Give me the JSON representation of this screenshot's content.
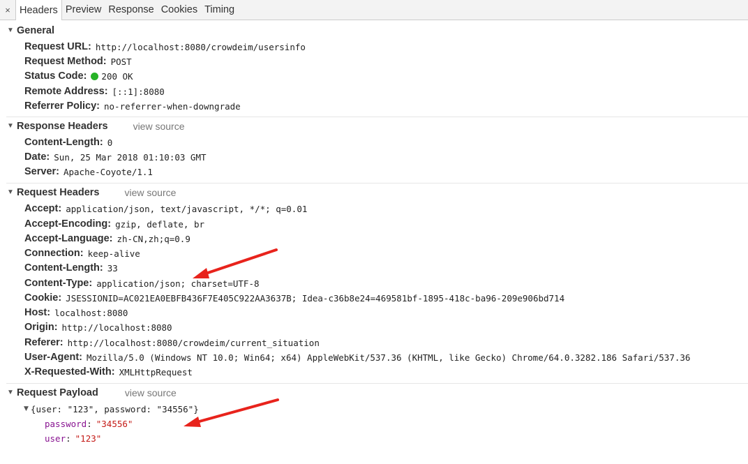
{
  "tabs": {
    "close": "×",
    "items": [
      "Headers",
      "Preview",
      "Response",
      "Cookies",
      "Timing"
    ]
  },
  "general": {
    "title": "General",
    "rows": [
      {
        "key": "Request URL:",
        "value": "http://localhost:8080/crowdeim/usersinfo"
      },
      {
        "key": "Request Method:",
        "value": "POST"
      },
      {
        "key": "Status Code:",
        "value": "200 OK"
      },
      {
        "key": "Remote Address:",
        "value": "[::1]:8080"
      },
      {
        "key": "Referrer Policy:",
        "value": "no-referrer-when-downgrade"
      }
    ]
  },
  "response_headers": {
    "title": "Response Headers",
    "view_source": "view source",
    "rows": [
      {
        "key": "Content-Length:",
        "value": "0"
      },
      {
        "key": "Date:",
        "value": "Sun, 25 Mar 2018 01:10:03 GMT"
      },
      {
        "key": "Server:",
        "value": "Apache-Coyote/1.1"
      }
    ]
  },
  "request_headers": {
    "title": "Request Headers",
    "view_source": "view source",
    "rows": [
      {
        "key": "Accept:",
        "value": "application/json, text/javascript, */*; q=0.01"
      },
      {
        "key": "Accept-Encoding:",
        "value": "gzip, deflate, br"
      },
      {
        "key": "Accept-Language:",
        "value": "zh-CN,zh;q=0.9"
      },
      {
        "key": "Connection:",
        "value": "keep-alive"
      },
      {
        "key": "Content-Length:",
        "value": "33"
      },
      {
        "key": "Content-Type:",
        "value": "application/json; charset=UTF-8"
      },
      {
        "key": "Cookie:",
        "value": "JSESSIONID=AC021EA0EBFB436F7E405C922AA3637B; Idea-c36b8e24=469581bf-1895-418c-ba96-209e906bd714"
      },
      {
        "key": "Host:",
        "value": "localhost:8080"
      },
      {
        "key": "Origin:",
        "value": "http://localhost:8080"
      },
      {
        "key": "Referer:",
        "value": "http://localhost:8080/crowdeim/current_situation"
      },
      {
        "key": "User-Agent:",
        "value": "Mozilla/5.0 (Windows NT 10.0; Win64; x64) AppleWebKit/537.36 (KHTML, like Gecko) Chrome/64.0.3282.186 Safari/537.36"
      },
      {
        "key": "X-Requested-With:",
        "value": "XMLHttpRequest"
      }
    ]
  },
  "request_payload": {
    "title": "Request Payload",
    "view_source": "view source",
    "object_summary": "{user: \"123\", password: \"34556\"}",
    "props": [
      {
        "key": "password",
        "value": "\"34556\""
      },
      {
        "key": "user",
        "value": "\"123\""
      }
    ]
  },
  "colors": {
    "status_dot": "#27b327",
    "annotation_arrow": "#e8231c",
    "prop_key": "#881391",
    "prop_string": "#c41a16"
  },
  "icons": {
    "collapse": "triangle-down-icon",
    "close": "close-icon",
    "status": "status-dot-icon"
  }
}
